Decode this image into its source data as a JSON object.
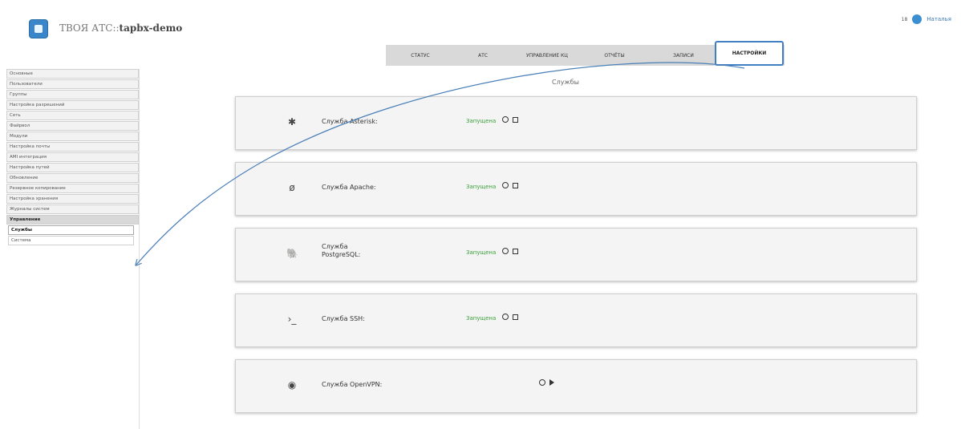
{
  "header": {
    "brand_prefix": "ТВОЯ АТС::",
    "brand_name": "tapbx-demo",
    "user_badge": "18",
    "user_name": "Наталья"
  },
  "tabs": [
    {
      "label": "СТАТУС"
    },
    {
      "label": "АТС"
    },
    {
      "label": "УПРАВЛЕНИЕ КЦ"
    },
    {
      "label": "ОТЧЁТЫ"
    },
    {
      "label": "ЗАПИСИ"
    },
    {
      "label": "НАСТРОЙКИ",
      "active": true
    }
  ],
  "sidebar": {
    "items": [
      "Основные",
      "Пользователи",
      "Группы",
      "Настройка разрешений",
      "Сеть",
      "Файрвол",
      "Модули",
      "Настройка почты",
      "AMI интеграция",
      "Настройка путей",
      "Обновление",
      "Резервное копирование",
      "Настройка хранения",
      "Журналы систем"
    ],
    "group": "Управление",
    "sub_items": [
      "Службы",
      "Система"
    ]
  },
  "section_title": "Службы",
  "services": [
    {
      "icon": "asterisk-icon",
      "glyph": "✱",
      "name": "Служба Asterisk:",
      "status": "Запущена",
      "controls": [
        "restart",
        "stop"
      ]
    },
    {
      "icon": "apache-feather-icon",
      "glyph": "ø",
      "name": "Служба Apache:",
      "status": "Запущена",
      "controls": [
        "restart",
        "stop"
      ]
    },
    {
      "icon": "postgresql-icon",
      "glyph": "🐘",
      "name": "Служба PostgreSQL:",
      "status": "Запущена",
      "controls": [
        "restart",
        "stop"
      ]
    },
    {
      "icon": "terminal-icon",
      "glyph": "›_",
      "name": "Служба SSH:",
      "status": "Запущена",
      "controls": [
        "restart",
        "stop"
      ]
    },
    {
      "icon": "openvpn-icon",
      "glyph": "◉",
      "name": "Служба OpenVPN:",
      "status": "",
      "controls": [
        "restart",
        "start"
      ]
    }
  ],
  "colors": {
    "accent": "#3f7fc2",
    "status_running": "#3aa03a",
    "tab_bar": "#d9d9d9"
  }
}
